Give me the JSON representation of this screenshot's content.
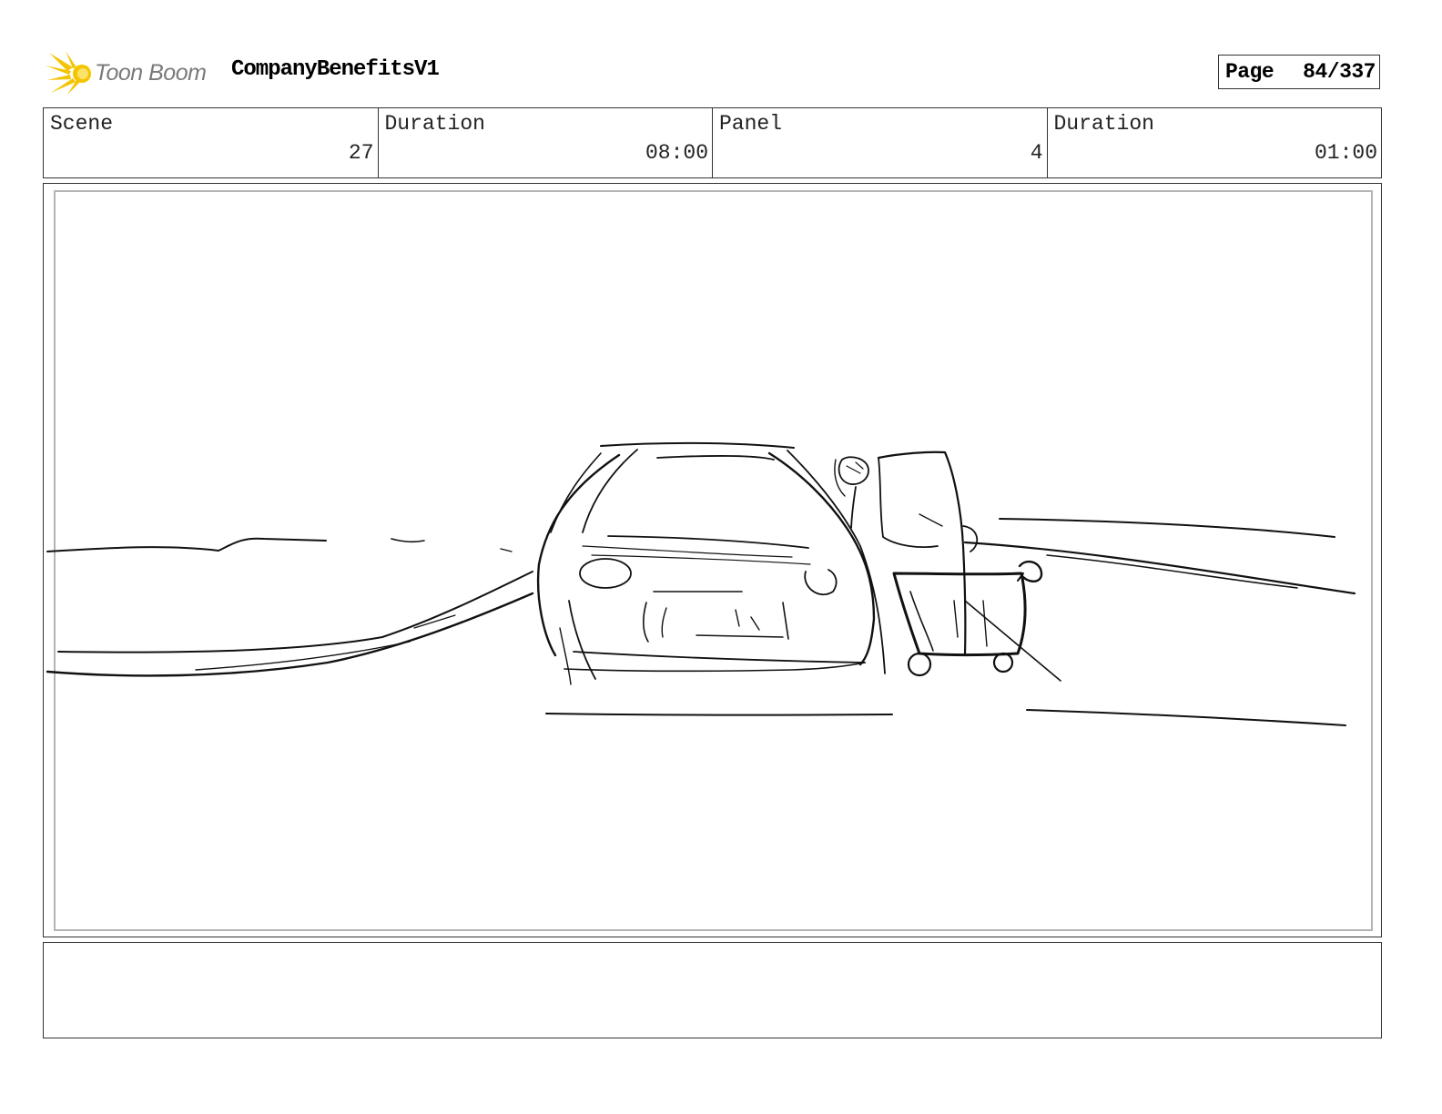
{
  "header": {
    "logo_text": "Toon Boom",
    "project_title": "CompanyBenefitsV1",
    "page_label": "Page",
    "page_value": "84/337"
  },
  "info": {
    "scene_label": "Scene",
    "scene_value": "27",
    "scene_duration_label": "Duration",
    "scene_duration_value": "08:00",
    "panel_label": "Panel",
    "panel_value": "4",
    "panel_duration_label": "Duration",
    "panel_duration_value": "01:00"
  },
  "icons": {
    "logo": "toon-boom-sunburst-icon"
  },
  "colors": {
    "logo_yellow": "#f5c400",
    "logo_text_gray": "#7a7a7a",
    "frame_gray": "#b4b4b4"
  }
}
